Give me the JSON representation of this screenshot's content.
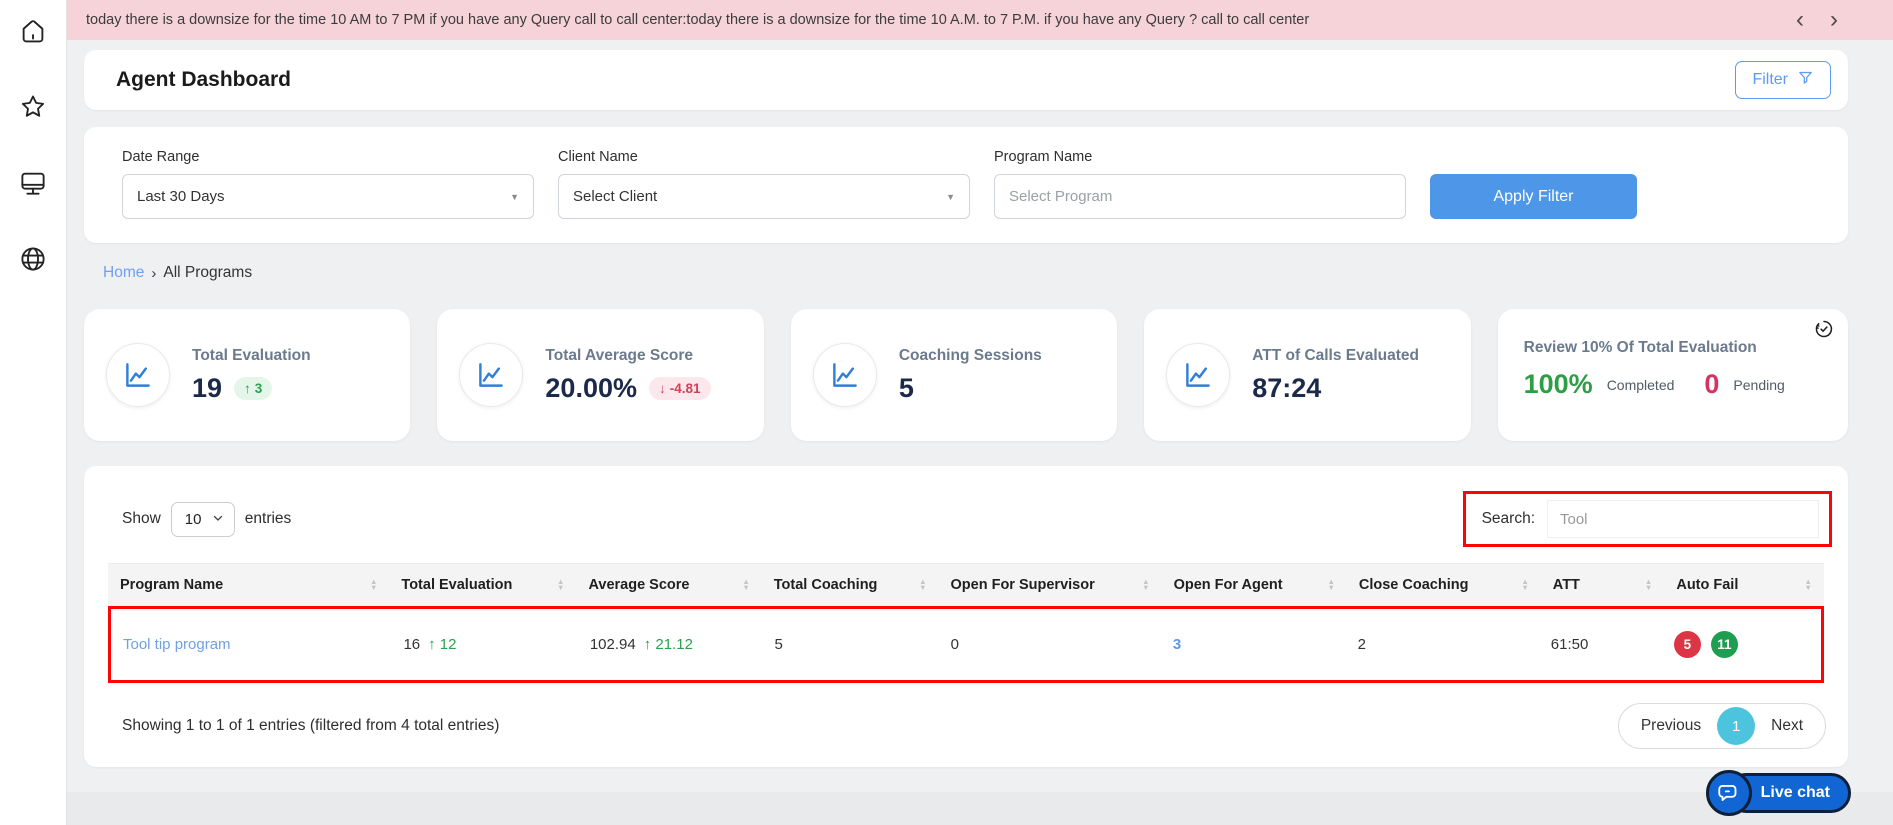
{
  "banner": {
    "text": "today there is a downsize for the time 10 AM to 7 PM if you have any Query call to call center:today there is a downsize for the time 10 A.M. to 7 P.M. if you have any Query ? call to call center"
  },
  "icons": {
    "chevron_left": "‹",
    "chevron_right": "›",
    "caret_down": "▼",
    "sort_up": "▲",
    "sort_down": "▼",
    "arrow_up": "↑",
    "arrow_down": "↓",
    "breadcrumb_sep": "›"
  },
  "header": {
    "title": "Agent Dashboard",
    "filter_label": "Filter"
  },
  "filters": {
    "date_range": {
      "label": "Date Range",
      "value": "Last 30 Days"
    },
    "client_name": {
      "label": "Client Name",
      "value": "Select Client"
    },
    "program_name": {
      "label": "Program Name",
      "placeholder": "Select Program"
    },
    "apply_label": "Apply Filter"
  },
  "breadcrumb": {
    "home": "Home",
    "current": "All Programs"
  },
  "stat_cards": [
    {
      "label": "Total Evaluation",
      "value": "19",
      "delta": "3",
      "delta_dir": "up"
    },
    {
      "label": "Total Average Score",
      "value": "20.00%",
      "delta": "-4.81",
      "delta_dir": "down"
    },
    {
      "label": "Coaching Sessions",
      "value": "5"
    },
    {
      "label": "ATT of Calls Evaluated",
      "value": "87:24"
    },
    {
      "label": "Review 10% Of Total Evaluation",
      "percent": "100%",
      "completed_label": "Completed",
      "pending_value": "0",
      "pending_label": "Pending"
    }
  ],
  "table": {
    "show_label": "Show",
    "show_value": "10",
    "entries_label": "entries",
    "search_label": "Search:",
    "search_value": "Tool",
    "columns": [
      "Program Name",
      "Total Evaluation",
      "Average Score",
      "Total Coaching",
      "Open For Supervisor",
      "Open For Agent",
      "Close Coaching",
      "ATT",
      "Auto Fail"
    ],
    "rows": [
      {
        "program_name": "Tool tip program",
        "total_evaluation": "16",
        "total_evaluation_delta": "12",
        "average_score": "102.94",
        "average_score_delta": "21.12",
        "total_coaching": "5",
        "open_for_supervisor": "0",
        "open_for_agent": "3",
        "close_coaching": "2",
        "att": "61:50",
        "auto_fail_red": "5",
        "auto_fail_green": "11"
      }
    ],
    "footer_text": "Showing 1 to 1 of 1 entries (filtered from 4 total entries)",
    "pagination": {
      "previous": "Previous",
      "page": "1",
      "next": "Next"
    }
  },
  "live_chat": {
    "label": "Live chat"
  },
  "colors": {
    "accent_blue": "#5b9bf0",
    "apply_blue": "#4d96e8",
    "link_blue": "#6fa1e6",
    "green": "#2aa14c",
    "red": "#d24157",
    "badge_red": "#dc3545",
    "badge_green": "#1e9e50",
    "banner_pink": "#f5d3d8",
    "active_page_cyan": "#4cc4dd",
    "annotation_red": "#fe0505"
  }
}
